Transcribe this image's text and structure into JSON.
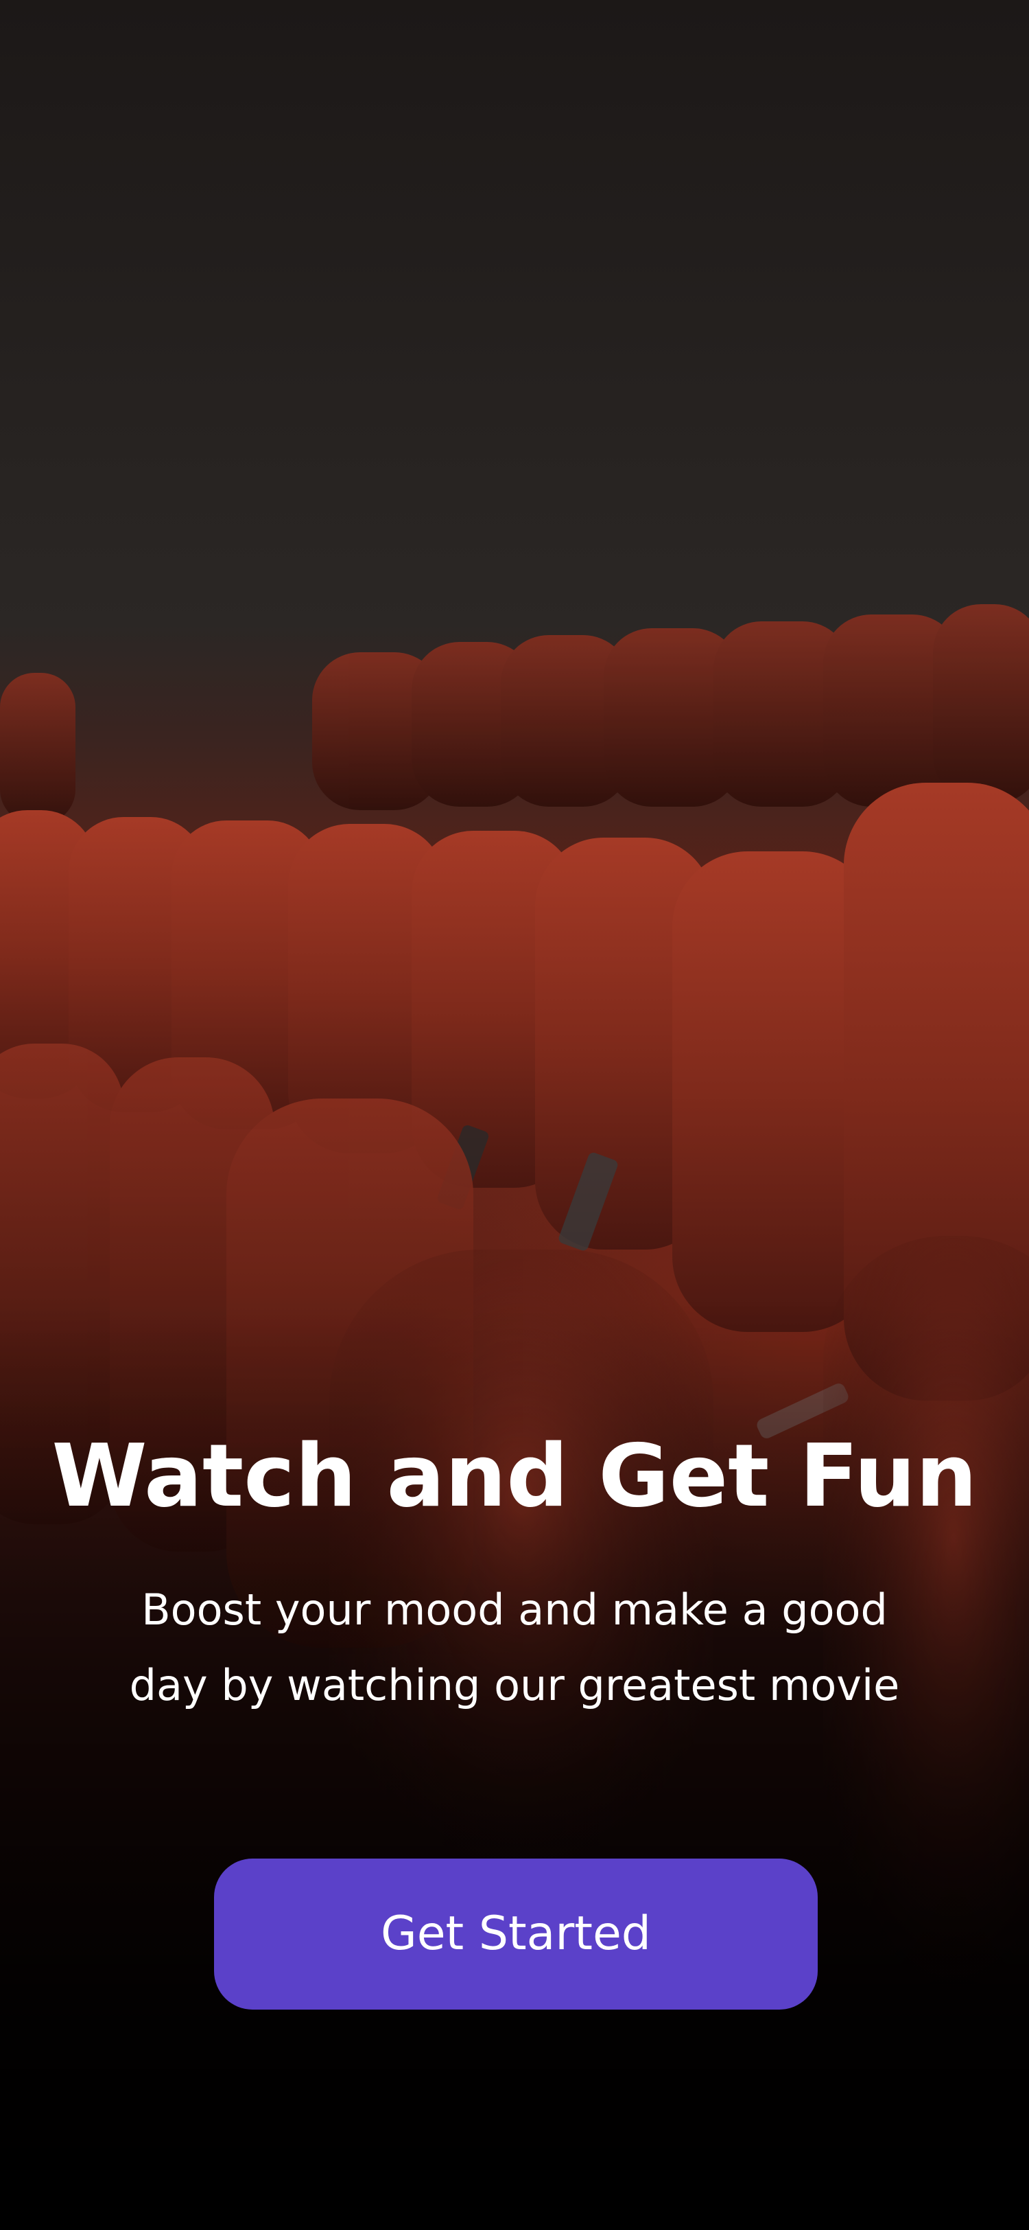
{
  "onboarding": {
    "title": "Watch and Get Fun",
    "subtitle": "Boost your mood and make a good day by watching our greatest movie",
    "cta_label": "Get Started"
  },
  "colors": {
    "accent": "#5b41c9",
    "seat_red": "#8a2e1e",
    "text": "#ffffff"
  },
  "background": {
    "icon": "cinema-seats-photo"
  }
}
